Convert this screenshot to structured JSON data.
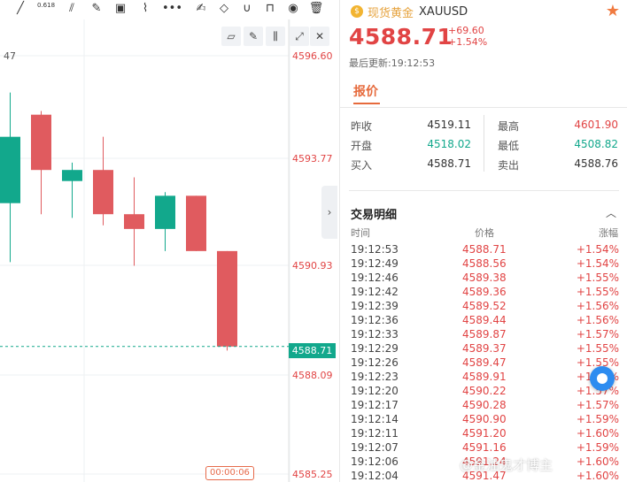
{
  "toolbar": {
    "icons": [
      "trend-line-icon",
      "fib-icon",
      "pitchfork-icon",
      "brush-icon",
      "image-icon",
      "path-icon",
      "more-icon",
      "note-icon",
      "eraser-icon",
      "magnet-icon",
      "lock-icon",
      "eye-icon",
      "trash-icon"
    ],
    "fib_text": "0.618",
    "more": "•••"
  },
  "chart": {
    "partial_label": "47",
    "y_ticks": [
      "4596.60",
      "4593.77",
      "4590.93",
      "4588.09",
      "4585.25"
    ],
    "last_price": "4588.71",
    "countdown": "00:00:06",
    "colors": {
      "up": "#e05b5f",
      "down": "#12a88c",
      "grid": "#eef0f3"
    }
  },
  "chart_data": {
    "type": "candlestick",
    "ylim": [
      4585.25,
      4596.6
    ],
    "candles": [
      {
        "open": 4592.6,
        "close": 4594.4,
        "high": 4595.6,
        "low": 4591.0
      },
      {
        "open": 4595.0,
        "close": 4593.5,
        "high": 4595.1,
        "low": 4592.3
      },
      {
        "open": 4593.2,
        "close": 4593.5,
        "high": 4593.7,
        "low": 4592.2
      },
      {
        "open": 4593.5,
        "close": 4592.3,
        "high": 4594.4,
        "low": 4592.0
      },
      {
        "open": 4592.3,
        "close": 4591.9,
        "high": 4593.3,
        "low": 4590.9
      },
      {
        "open": 4591.9,
        "close": 4592.8,
        "high": 4592.9,
        "low": 4591.3
      },
      {
        "open": 4592.8,
        "close": 4591.3,
        "high": 4592.8,
        "low": 4591.3
      },
      {
        "open": 4591.3,
        "close": 4588.71,
        "high": 4591.3,
        "low": 4588.6
      }
    ]
  },
  "panel": {
    "symbol_name": "现货黄金",
    "symbol_code": "XAUUSD",
    "coin_glyph": "$",
    "star": "★",
    "price": "4588.71",
    "change": "+69.60",
    "change_pct": "+1.54%",
    "updated": "最后更新:19:12:53",
    "tab": "报价",
    "quote": {
      "prev_close_label": "昨收",
      "prev_close": "4519.11",
      "open_label": "开盘",
      "open": "4518.02",
      "bid_label": "买入",
      "bid": "4588.71",
      "high_label": "最高",
      "high": "4601.90",
      "low_label": "最低",
      "low": "4508.82",
      "ask_label": "卖出",
      "ask": "4588.76"
    },
    "trades_title": "交易明细",
    "trades_toggle": "︿",
    "headers": {
      "time": "时间",
      "price": "价格",
      "change": "涨幅"
    },
    "collapse_glyph": "›",
    "trades": [
      {
        "time": "19:12:53",
        "price": "4588.71",
        "chg": "+1.54%"
      },
      {
        "time": "19:12:49",
        "price": "4588.56",
        "chg": "+1.54%"
      },
      {
        "time": "19:12:46",
        "price": "4589.38",
        "chg": "+1.55%"
      },
      {
        "time": "19:12:42",
        "price": "4589.36",
        "chg": "+1.55%"
      },
      {
        "time": "19:12:39",
        "price": "4589.52",
        "chg": "+1.56%"
      },
      {
        "time": "19:12:36",
        "price": "4589.44",
        "chg": "+1.56%"
      },
      {
        "time": "19:12:33",
        "price": "4589.87",
        "chg": "+1.57%"
      },
      {
        "time": "19:12:29",
        "price": "4589.37",
        "chg": "+1.55%"
      },
      {
        "time": "19:12:26",
        "price": "4589.47",
        "chg": "+1.55%"
      },
      {
        "time": "19:12:23",
        "price": "4589.91",
        "chg": "+1.57%"
      },
      {
        "time": "19:12:20",
        "price": "4590.22",
        "chg": "+1.57%"
      },
      {
        "time": "19:12:17",
        "price": "4590.28",
        "chg": "+1.57%"
      },
      {
        "time": "19:12:14",
        "price": "4590.90",
        "chg": "+1.59%"
      },
      {
        "time": "19:12:11",
        "price": "4591.20",
        "chg": "+1.60%"
      },
      {
        "time": "19:12:07",
        "price": "4591.16",
        "chg": "+1.59%"
      },
      {
        "time": "19:12:06",
        "price": "4591.24",
        "chg": "+1.60%"
      },
      {
        "time": "19:12:04",
        "price": "4591.47",
        "chg": "+1.60%"
      }
    ],
    "watermark": "@金油鬼才博主"
  }
}
